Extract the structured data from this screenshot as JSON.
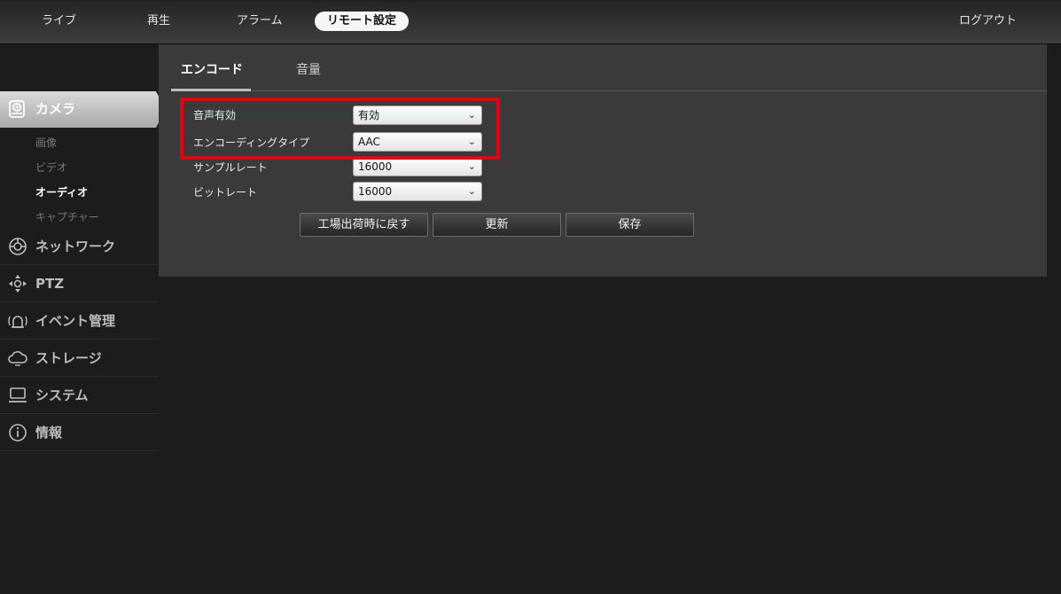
{
  "topnav": {
    "live": "ライブ",
    "playback": "再生",
    "alarm": "アラーム",
    "remote_settings": "リモート設定",
    "logout": "ログアウト"
  },
  "sidebar": {
    "camera": "カメラ",
    "camera_sub": {
      "image": "画像",
      "video": "ビデオ",
      "audio": "オーディオ",
      "capture": "キャプチャー"
    },
    "network": "ネットワーク",
    "ptz": "PTZ",
    "event": "イベント管理",
    "storage": "ストレージ",
    "system": "システム",
    "info": "情報"
  },
  "tabs": {
    "encode": "エンコード",
    "volume": "音量"
  },
  "form": {
    "audio_enable": {
      "label": "音声有効",
      "value": "有効"
    },
    "encoding_type": {
      "label": "エンコーディングタイプ",
      "value": "AAC"
    },
    "sample_rate": {
      "label": "サンプルレート",
      "value": "16000"
    },
    "bitrate": {
      "label": "ビットレート",
      "value": "16000"
    }
  },
  "buttons": {
    "factory_reset": "工場出荷時に戻す",
    "refresh": "更新",
    "save": "保存"
  },
  "colors": {
    "highlight": "#e8000d",
    "active_menu": "#c8c8c8"
  }
}
